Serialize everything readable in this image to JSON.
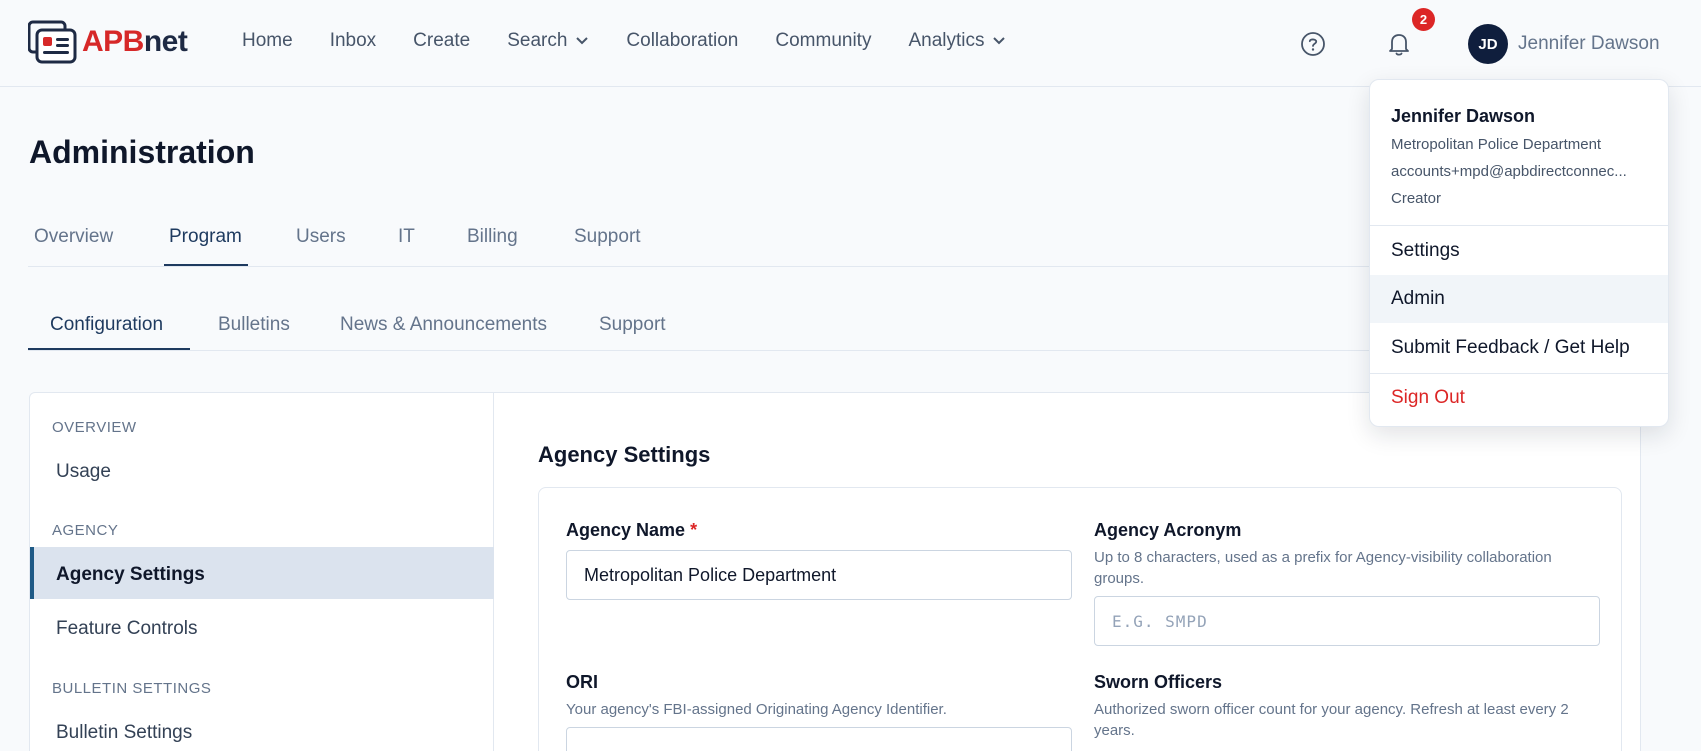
{
  "brand": {
    "prefix": "APB",
    "suffix": "net"
  },
  "nav": {
    "home": "Home",
    "inbox": "Inbox",
    "create": "Create",
    "search": "Search",
    "collaboration": "Collaboration",
    "community": "Community",
    "analytics": "Analytics"
  },
  "header": {
    "notification_count": "2",
    "avatar_initials": "JD",
    "user_name": "Jennifer Dawson"
  },
  "page": {
    "title": "Administration"
  },
  "tabs": {
    "overview": "Overview",
    "program": "Program",
    "users": "Users",
    "it": "IT",
    "billing": "Billing",
    "support": "Support"
  },
  "subtabs": {
    "configuration": "Configuration",
    "bulletins": "Bulletins",
    "news": "News & Announcements",
    "support": "Support"
  },
  "sidebar": {
    "overview_section": "OVERVIEW",
    "usage": "Usage",
    "agency_section": "AGENCY",
    "agency_settings": "Agency Settings",
    "feature_controls": "Feature Controls",
    "bulletin_section": "BULLETIN SETTINGS",
    "bulletin_settings": "Bulletin Settings"
  },
  "form": {
    "section_title": "Agency Settings",
    "agency_name_label": "Agency Name",
    "required_mark": "*",
    "agency_name_value": "Metropolitan Police Department",
    "acronym_label": "Agency Acronym",
    "acronym_help": "Up to 8 characters, used as a prefix for Agency-visibility collaboration groups.",
    "acronym_placeholder": "E.G. SMPD",
    "ori_label": "ORI",
    "ori_help": "Your agency's FBI-assigned Originating Agency Identifier.",
    "sworn_label": "Sworn Officers",
    "sworn_help": "Authorized sworn officer count for your agency. Refresh at least every 2 years."
  },
  "user_menu": {
    "name": "Jennifer Dawson",
    "department": "Metropolitan Police Department",
    "email": "accounts+mpd@apbdirectconnec...",
    "role": "Creator",
    "settings": "Settings",
    "admin": "Admin",
    "feedback": "Submit Feedback / Get Help",
    "sign_out": "Sign Out"
  },
  "colors": {
    "accent": "#1e3a5f",
    "brand_red": "#d62828",
    "danger": "#dc2626",
    "avatar_bg": "#0f1e3d"
  }
}
